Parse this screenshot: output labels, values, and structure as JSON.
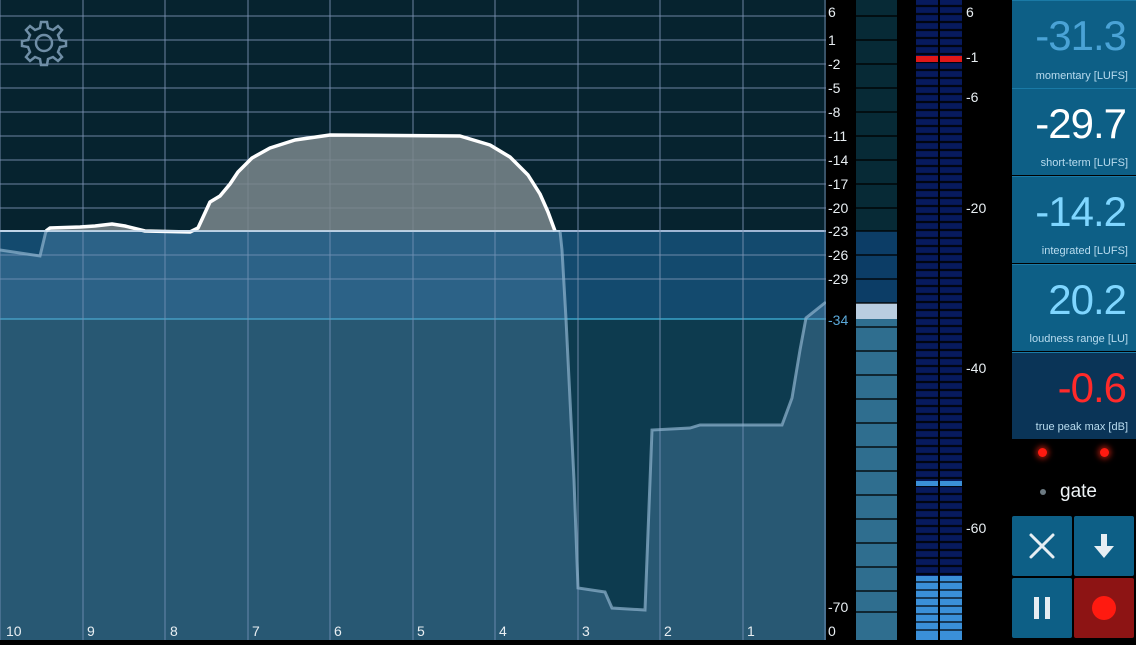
{
  "graph": {
    "y_labels": [
      "6",
      "1",
      "-2",
      "-5",
      "-8",
      "-11",
      "-14",
      "-17",
      "-20",
      "-23",
      "-26",
      "-29",
      "-34",
      "-70"
    ],
    "x_labels": [
      "10",
      "9",
      "8",
      "7",
      "6",
      "5",
      "4",
      "3",
      "2",
      "1",
      "0"
    ],
    "target_label": "-34"
  },
  "peak_meter": {
    "scale_labels": [
      "6",
      "-1",
      "-6",
      "-20",
      "-40",
      "-60"
    ]
  },
  "readouts": [
    {
      "value": "-31.3",
      "label": "momentary [LUFS]",
      "color": "#4aa3d6"
    },
    {
      "value": "-29.7",
      "label": "short-term [LUFS]",
      "color": "#ffffff"
    },
    {
      "value": "-14.2",
      "label": "integrated [LUFS]",
      "color": "#7fd6ff"
    },
    {
      "value": "20.2",
      "label": "loudness range [LU]",
      "color": "#7fd6ff"
    },
    {
      "value": "-0.6",
      "label": "true peak max [dB]",
      "color": "#ff2a2a"
    }
  ],
  "gate": {
    "label": "gate"
  },
  "colors": {
    "accent": "#0d5f86",
    "record": "#ff1a10",
    "peak_marker": "#e01818"
  },
  "icons": {
    "settings": "gear-icon",
    "clear": "close-icon",
    "download": "download-icon",
    "pause": "pause-icon",
    "record": "record-icon"
  }
}
